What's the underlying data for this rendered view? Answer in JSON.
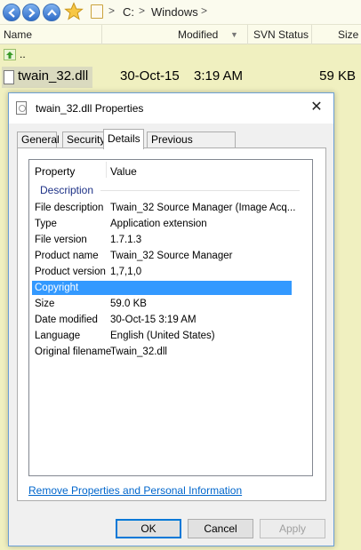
{
  "explorer": {
    "address": {
      "sep1": ">",
      "drive": "C:",
      "sep2": ">",
      "folder": "Windows",
      "sep3": ">"
    },
    "columns": {
      "name": "Name",
      "modified": "Modified",
      "sort_indicator": "▼",
      "svn": "SVN Status",
      "size": "Size"
    },
    "up_row": {
      "label": ".."
    },
    "file": {
      "name": "twain_32.dll",
      "date": "30-Oct-15",
      "time": "3:19 AM",
      "size": "59 KB"
    }
  },
  "dialog": {
    "title": "twain_32.dll Properties",
    "close_glyph": "✕",
    "tabs": [
      "General",
      "Security",
      "Details",
      "Previous Versions"
    ],
    "active_tab": "Details",
    "list": {
      "header_property": "Property",
      "header_value": "Value",
      "group": "Description",
      "rows": [
        {
          "k": "File description",
          "v": "Twain_32 Source Manager (Image Acq..."
        },
        {
          "k": "Type",
          "v": "Application extension"
        },
        {
          "k": "File version",
          "v": "1.7.1.3"
        },
        {
          "k": "Product name",
          "v": "Twain_32 Source Manager"
        },
        {
          "k": "Product version",
          "v": "1,7,1,0"
        },
        {
          "k": "Copyright",
          "v": ""
        },
        {
          "k": "Size",
          "v": "59.0 KB"
        },
        {
          "k": "Date modified",
          "v": "30-Oct-15 3:19 AM"
        },
        {
          "k": "Language",
          "v": "English (United States)"
        },
        {
          "k": "Original filename",
          "v": "Twain_32.dll"
        }
      ],
      "selected_row": "Copyright"
    },
    "link": "Remove Properties and Personal Information",
    "buttons": {
      "ok": "OK",
      "cancel": "Cancel",
      "apply": "Apply"
    }
  },
  "colors": {
    "selection": "#3399ff",
    "link": "#0066cc",
    "background": "#f0f0c0"
  }
}
